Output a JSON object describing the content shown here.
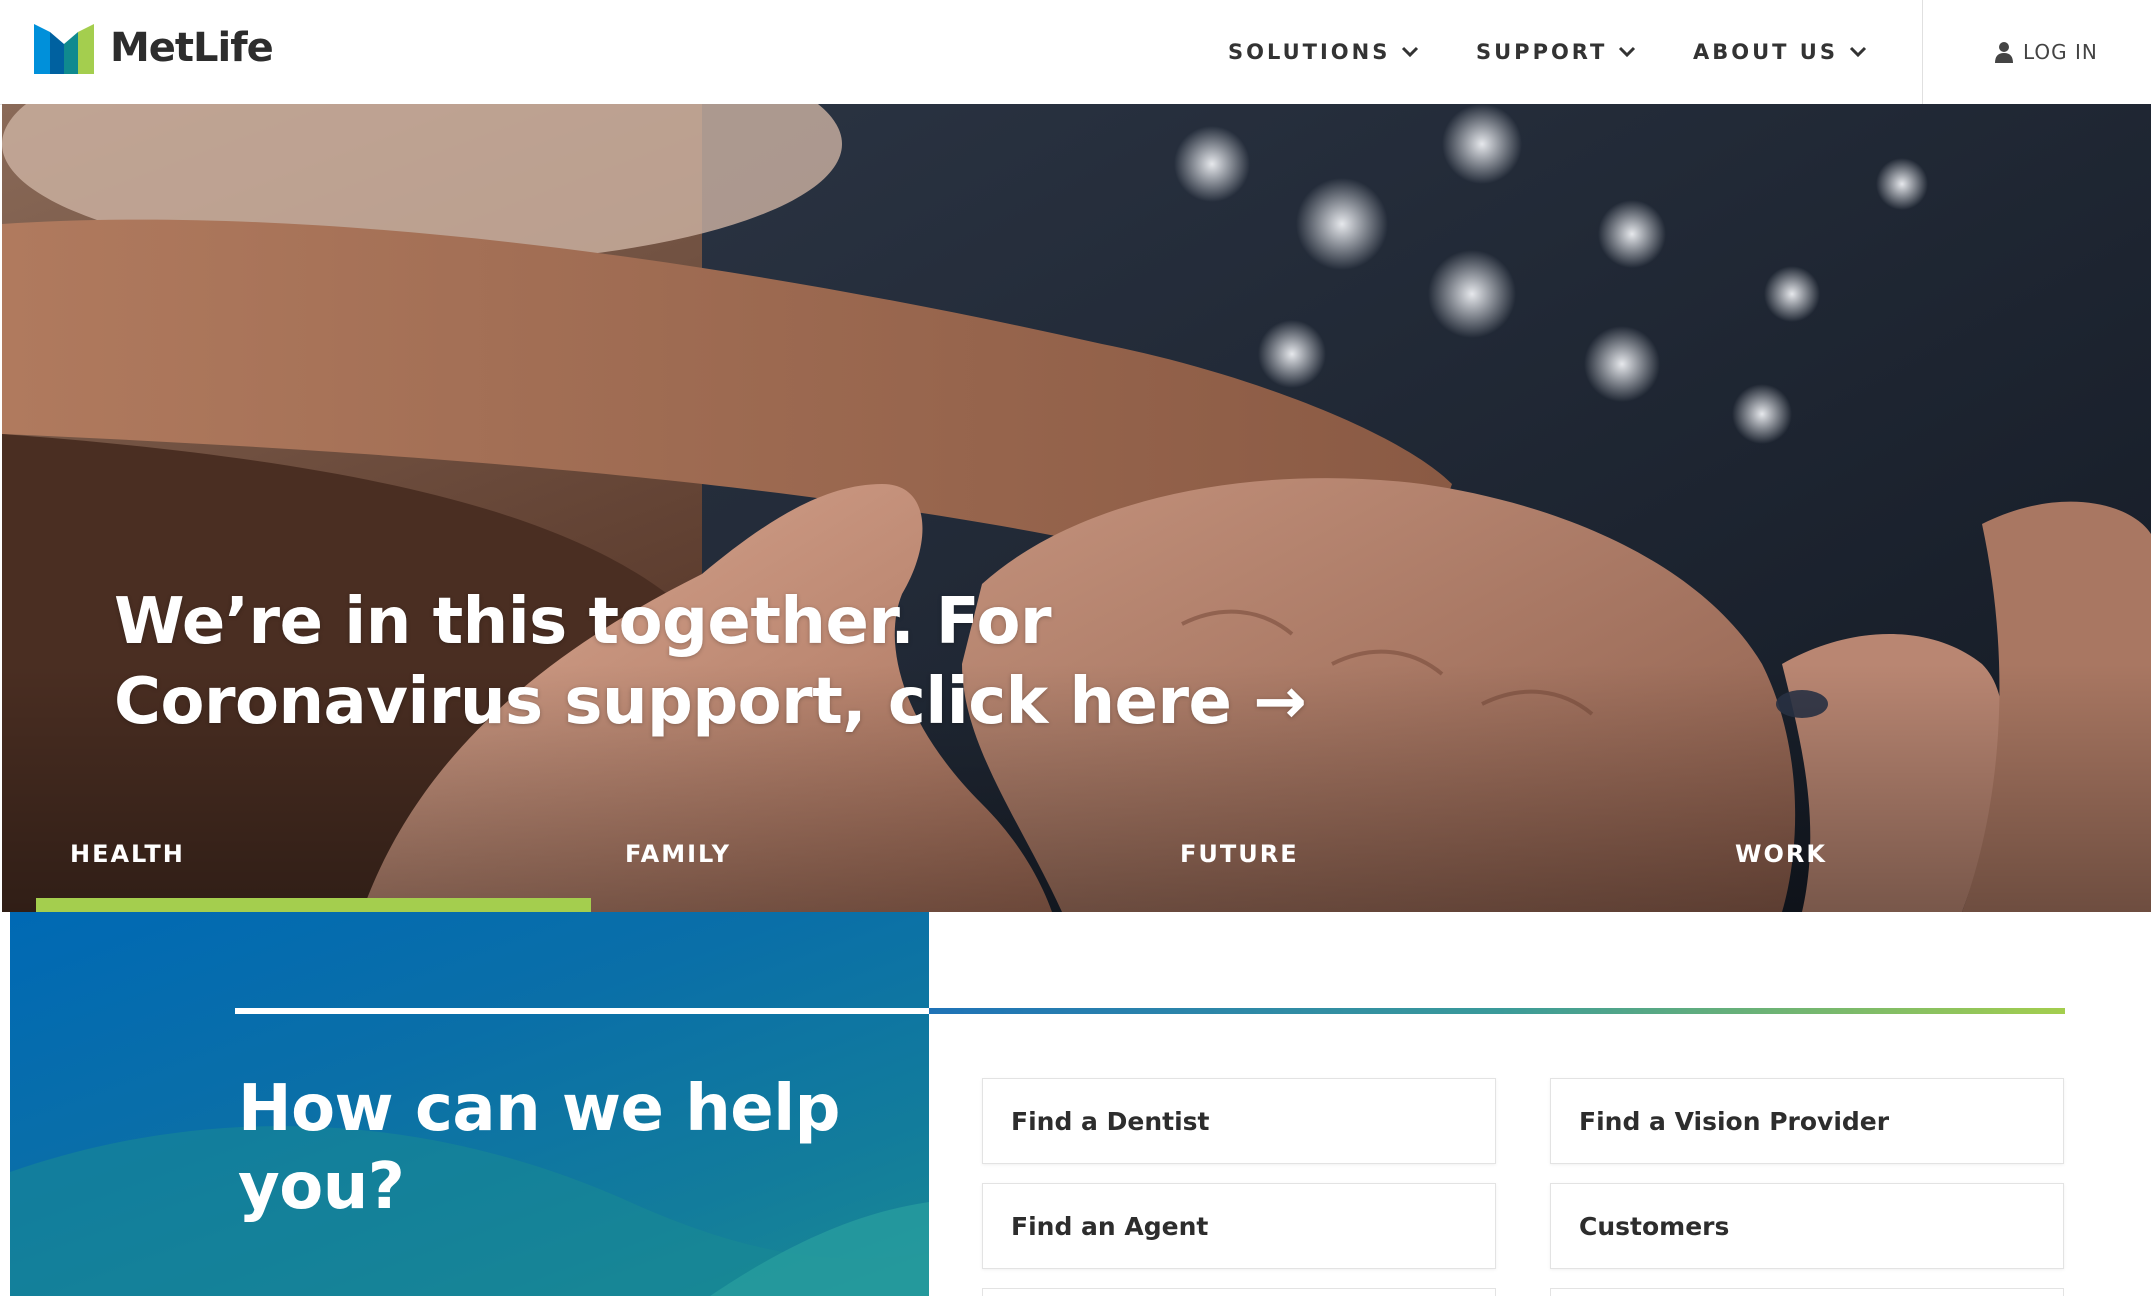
{
  "header": {
    "logo_text": "MetLife",
    "logo_icon": "metlife-m-logo-icon",
    "nav": [
      {
        "label": "SOLUTIONS",
        "icon": "chevron-down-icon"
      },
      {
        "label": "SUPPORT",
        "icon": "chevron-down-icon"
      },
      {
        "label": "ABOUT US",
        "icon": "chevron-down-icon"
      }
    ],
    "login": {
      "label": "LOG IN",
      "icon": "user-icon"
    }
  },
  "hero": {
    "headline_line1": "We’re in this together. For",
    "headline_line2": "Coronavirus support, click here →",
    "tabs": [
      {
        "label": "HEALTH",
        "active": true
      },
      {
        "label": "FAMILY",
        "active": false
      },
      {
        "label": "FUTURE",
        "active": false
      },
      {
        "label": "WORK",
        "active": false
      }
    ]
  },
  "help": {
    "title": "How can we help you?",
    "links": [
      {
        "label": "Find a Dentist"
      },
      {
        "label": "Find a Vision Provider"
      },
      {
        "label": "Find an Agent"
      },
      {
        "label": "Customers"
      }
    ]
  },
  "colors": {
    "brand_blue": "#0069b4",
    "brand_green": "#a4ce4e",
    "teal": "#1a8a94",
    "text_dark": "#2d2d2d"
  }
}
